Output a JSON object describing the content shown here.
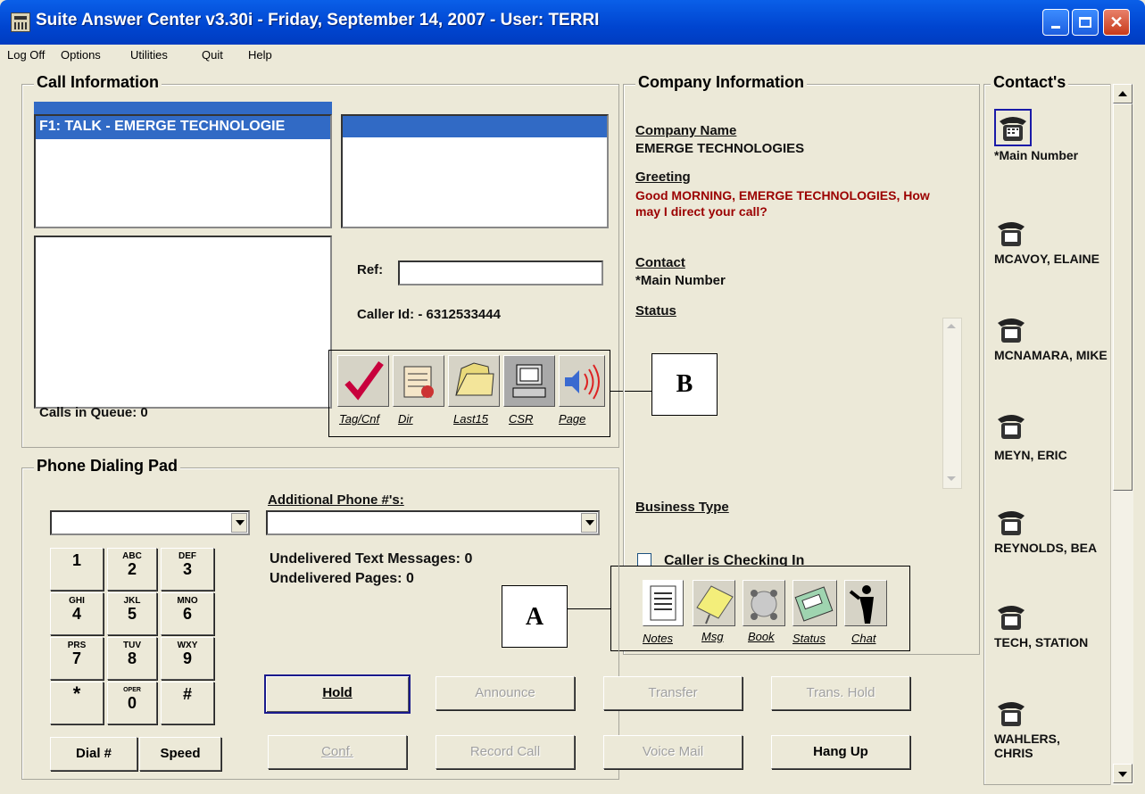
{
  "window": {
    "title": "Suite Answer Center v3.30i - Friday, September 14, 2007 - User: TERRI"
  },
  "menu": [
    "Log Off",
    "Options",
    "Utilities",
    "Quit",
    "Help"
  ],
  "call_info": {
    "legend": "Call Information",
    "active_line": "F1: TALK - EMERGE TECHNOLOGIE",
    "ref_label": "Ref:",
    "ref_value": "",
    "caller_id": "Caller Id:  - 6312533444",
    "calls_in_queue": "Calls in Queue: 0",
    "tools": [
      {
        "label": "Tag/Cnf",
        "icon": "checkmark-icon"
      },
      {
        "label": "Dir",
        "icon": "directory-icon"
      },
      {
        "label": "Last15",
        "icon": "folder-icon"
      },
      {
        "label": "CSR",
        "icon": "computer-icon"
      },
      {
        "label": "Page",
        "icon": "speaker-icon"
      }
    ]
  },
  "company": {
    "legend": "Company Information",
    "name_label": "Company Name",
    "name": "EMERGE TECHNOLOGIES",
    "greeting_label": "Greeting",
    "greeting": "Good MORNING, EMERGE TECHNOLOGIES, How may I direct your call?",
    "contact_label": "Contact",
    "contact": "*Main Number",
    "status_label": "Status",
    "business_type_label": "Business Type",
    "checking_in_label": "Caller is Checking In",
    "tools": [
      {
        "label": "Notes",
        "icon": "notes-icon"
      },
      {
        "label": "Msg",
        "icon": "message-icon"
      },
      {
        "label": "Book",
        "icon": "book-icon"
      },
      {
        "label": "Status",
        "icon": "status-icon"
      },
      {
        "label": "Chat",
        "icon": "chat-icon"
      }
    ]
  },
  "dial_pad": {
    "legend": "Phone Dialing Pad",
    "additional_label": "Additional Phone #'s:",
    "undelivered_text": "Undelivered Text Messages: 0",
    "undelivered_pages": "Undelivered Pages: 0",
    "keys": [
      {
        "top": "",
        "digit": "1"
      },
      {
        "top": "ABC",
        "digit": "2"
      },
      {
        "top": "DEF",
        "digit": "3"
      },
      {
        "top": "GHI",
        "digit": "4"
      },
      {
        "top": "JKL",
        "digit": "5"
      },
      {
        "top": "MNO",
        "digit": "6"
      },
      {
        "top": "PRS",
        "digit": "7"
      },
      {
        "top": "TUV",
        "digit": "8"
      },
      {
        "top": "WXY",
        "digit": "9"
      },
      {
        "top": "",
        "digit": "*"
      },
      {
        "top": "OPER",
        "digit": "0"
      },
      {
        "top": "",
        "digit": "#"
      }
    ],
    "dial_label": "Dial #",
    "speed_label": "Speed"
  },
  "actions": {
    "hold": "Hold",
    "announce": "Announce",
    "transfer": "Transfer",
    "trans_hold": "Trans. Hold",
    "conf": "Conf.",
    "record_call": "Record Call",
    "voice_mail": "Voice Mail",
    "hang_up": "Hang Up"
  },
  "contacts": {
    "legend": "Contact's",
    "items": [
      "*Main Number",
      "MCAVOY, ELAINE",
      "MCNAMARA, MIKE",
      "MEYN, ERIC",
      "REYNOLDS, BEA",
      "TECH, STATION",
      "WAHLERS, CHRIS"
    ]
  },
  "callouts": {
    "a": "A",
    "b": "B"
  },
  "colors": {
    "selection": "#316AC5",
    "greeting": "#9B0000",
    "title_bar": "#0045D0"
  }
}
